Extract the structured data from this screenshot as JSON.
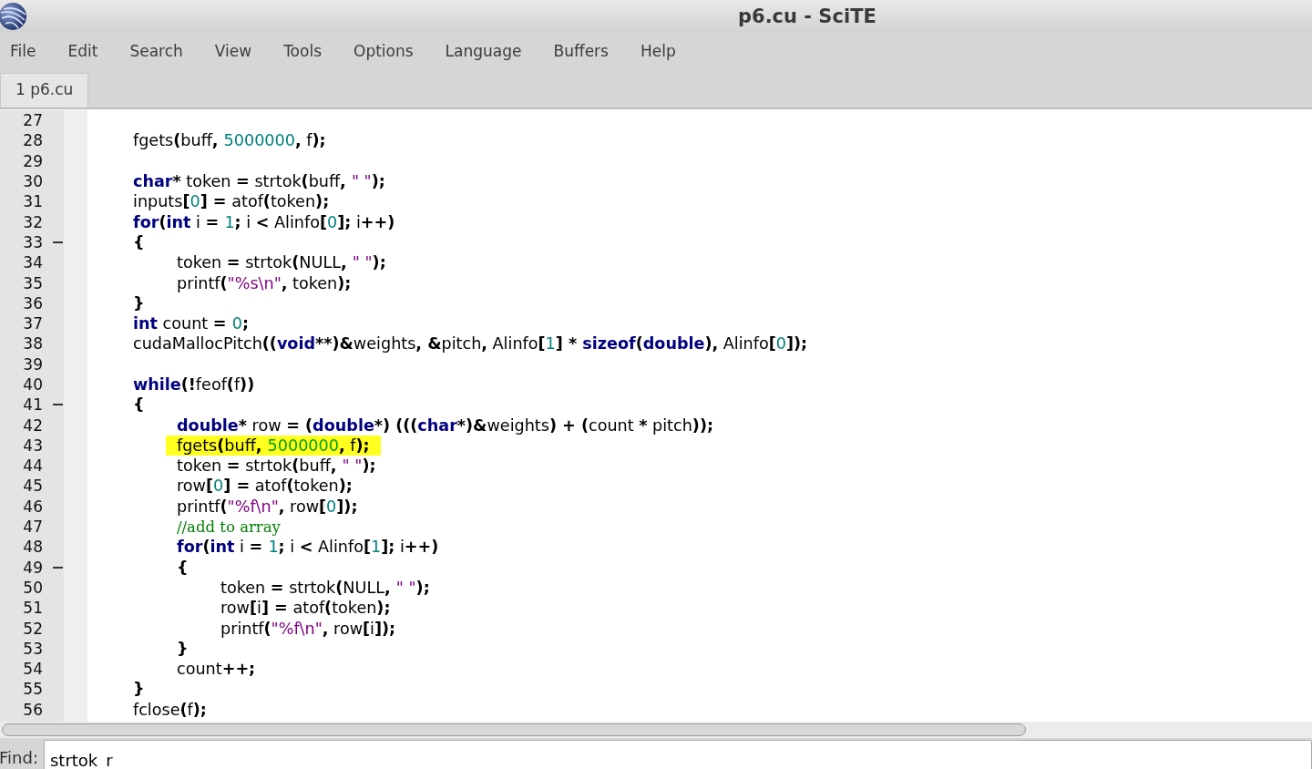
{
  "window": {
    "title": "p6.cu - SciTE"
  },
  "menu": [
    "File",
    "Edit",
    "Search",
    "View",
    "Tools",
    "Options",
    "Language",
    "Buffers",
    "Help"
  ],
  "tabs": [
    {
      "label": "1 p6.cu",
      "selected": true
    }
  ],
  "lines": [
    {
      "number": "27",
      "fold": false,
      "highlighted": false
    },
    {
      "number": "28",
      "fold": false,
      "highlighted": false,
      "segments": [
        {
          "kind": "id",
          "text": "fgets"
        },
        {
          "kind": "op",
          "text": "("
        },
        {
          "kind": "id",
          "text": "buff"
        },
        {
          "kind": "op",
          "text": ", "
        },
        {
          "kind": "num",
          "text": "5000000"
        },
        {
          "kind": "op",
          "text": ","
        },
        {
          "kind": "id",
          "text": " f"
        },
        {
          "kind": "op",
          "text": ");"
        }
      ]
    },
    {
      "number": "29",
      "fold": false,
      "highlighted": false
    },
    {
      "number": "30",
      "fold": false,
      "highlighted": false,
      "segments": [
        {
          "kind": "kw",
          "text": "char"
        },
        {
          "kind": "op",
          "text": "*"
        },
        {
          "kind": "id",
          "text": " token "
        },
        {
          "kind": "op",
          "text": "="
        },
        {
          "kind": "id",
          "text": " strtok"
        },
        {
          "kind": "op",
          "text": "("
        },
        {
          "kind": "id",
          "text": "buff"
        },
        {
          "kind": "op",
          "text": ", "
        },
        {
          "kind": "str",
          "text": "\" \""
        },
        {
          "kind": "op",
          "text": ");"
        }
      ]
    },
    {
      "number": "31",
      "fold": false,
      "highlighted": false,
      "segments": [
        {
          "kind": "id",
          "text": "inputs"
        },
        {
          "kind": "op",
          "text": "["
        },
        {
          "kind": "num",
          "text": "0"
        },
        {
          "kind": "op",
          "text": "] ="
        },
        {
          "kind": "id",
          "text": " atof"
        },
        {
          "kind": "op",
          "text": "("
        },
        {
          "kind": "id",
          "text": "token"
        },
        {
          "kind": "op",
          "text": ");"
        }
      ]
    },
    {
      "number": "32",
      "fold": false,
      "highlighted": false,
      "segments": [
        {
          "kind": "kw",
          "text": "for"
        },
        {
          "kind": "op",
          "text": "("
        },
        {
          "kind": "kw",
          "text": "int"
        },
        {
          "kind": "id",
          "text": " i "
        },
        {
          "kind": "op",
          "text": "= "
        },
        {
          "kind": "num",
          "text": "1"
        },
        {
          "kind": "op",
          "text": ";"
        },
        {
          "kind": "id",
          "text": " i "
        },
        {
          "kind": "op",
          "text": "<"
        },
        {
          "kind": "id",
          "text": " Alinfo"
        },
        {
          "kind": "op",
          "text": "["
        },
        {
          "kind": "num",
          "text": "0"
        },
        {
          "kind": "op",
          "text": "];"
        },
        {
          "kind": "id",
          "text": " i"
        },
        {
          "kind": "op",
          "text": "++)"
        }
      ]
    },
    {
      "number": "33",
      "fold": true,
      "highlighted": false,
      "segments": [
        {
          "kind": "op",
          "text": "{"
        }
      ],
      "children": [
        {
          "number": "34",
          "fold": false,
          "highlighted": false,
          "segments": [
            {
              "kind": "id",
              "text": "token "
            },
            {
              "kind": "op",
              "text": "="
            },
            {
              "kind": "id",
              "text": " strtok"
            },
            {
              "kind": "op",
              "text": "("
            },
            {
              "kind": "id",
              "text": "NULL"
            },
            {
              "kind": "op",
              "text": ", "
            },
            {
              "kind": "str",
              "text": "\" \""
            },
            {
              "kind": "op",
              "text": ");"
            }
          ]
        },
        {
          "number": "35",
          "fold": false,
          "highlighted": false,
          "segments": [
            {
              "kind": "id",
              "text": "printf"
            },
            {
              "kind": "op",
              "text": "("
            },
            {
              "kind": "str",
              "text": "\"%s\\n\""
            },
            {
              "kind": "op",
              "text": ","
            },
            {
              "kind": "id",
              "text": " token"
            },
            {
              "kind": "op",
              "text": ");"
            }
          ]
        }
      ]
    },
    {
      "number": "36",
      "fold": false,
      "highlighted": false,
      "segments": [
        {
          "kind": "op",
          "text": "}"
        }
      ]
    },
    {
      "number": "37",
      "fold": false,
      "highlighted": false,
      "segments": [
        {
          "kind": "kw",
          "text": "int"
        },
        {
          "kind": "id",
          "text": " count "
        },
        {
          "kind": "op",
          "text": "= "
        },
        {
          "kind": "num",
          "text": "0"
        },
        {
          "kind": "op",
          "text": ";"
        }
      ]
    },
    {
      "number": "38",
      "fold": false,
      "highlighted": false,
      "segments": [
        {
          "kind": "id",
          "text": "cudaMallocPitch"
        },
        {
          "kind": "op",
          "text": "(("
        },
        {
          "kind": "kw",
          "text": "void"
        },
        {
          "kind": "op",
          "text": "**)&"
        },
        {
          "kind": "id",
          "text": "weights"
        },
        {
          "kind": "op",
          "text": ", &"
        },
        {
          "kind": "id",
          "text": "pitch"
        },
        {
          "kind": "op",
          "text": ","
        },
        {
          "kind": "id",
          "text": " Alinfo"
        },
        {
          "kind": "op",
          "text": "["
        },
        {
          "kind": "num",
          "text": "1"
        },
        {
          "kind": "op",
          "text": "] * "
        },
        {
          "kind": "kw",
          "text": "sizeof"
        },
        {
          "kind": "op",
          "text": "("
        },
        {
          "kind": "kw",
          "text": "double"
        },
        {
          "kind": "op",
          "text": "),"
        },
        {
          "kind": "id",
          "text": " Alinfo"
        },
        {
          "kind": "op",
          "text": "["
        },
        {
          "kind": "num",
          "text": "0"
        },
        {
          "kind": "op",
          "text": "]);"
        }
      ]
    },
    {
      "number": "39",
      "fold": false,
      "highlighted": false
    },
    {
      "number": "40",
      "fold": false,
      "highlighted": false,
      "segments": [
        {
          "kind": "kw",
          "text": "while"
        },
        {
          "kind": "op",
          "text": "(!"
        },
        {
          "kind": "id",
          "text": "feof"
        },
        {
          "kind": "op",
          "text": "("
        },
        {
          "kind": "id",
          "text": "f"
        },
        {
          "kind": "op",
          "text": "))"
        }
      ]
    },
    {
      "number": "41",
      "fold": true,
      "highlighted": false,
      "segments": [
        {
          "kind": "op",
          "text": "{"
        }
      ],
      "children": [
        {
          "number": "42",
          "fold": false,
          "highlighted": false,
          "segments": [
            {
              "kind": "kw",
              "text": "double"
            },
            {
              "kind": "op",
              "text": "*"
            },
            {
              "kind": "id",
              "text": " row "
            },
            {
              "kind": "op",
              "text": "= ("
            },
            {
              "kind": "kw",
              "text": "double"
            },
            {
              "kind": "op",
              "text": "*) ((("
            },
            {
              "kind": "kw",
              "text": "char"
            },
            {
              "kind": "op",
              "text": "*)&"
            },
            {
              "kind": "id",
              "text": "weights"
            },
            {
              "kind": "op",
              "text": ") + ("
            },
            {
              "kind": "id",
              "text": "count "
            },
            {
              "kind": "op",
              "text": "*"
            },
            {
              "kind": "id",
              "text": " pitch"
            },
            {
              "kind": "op",
              "text": "));"
            }
          ]
        },
        {
          "number": "43",
          "fold": false,
          "highlighted": true,
          "segments": [
            {
              "kind": "id",
              "text": "fgets"
            },
            {
              "kind": "op",
              "text": "("
            },
            {
              "kind": "id",
              "text": "buff"
            },
            {
              "kind": "op",
              "text": ", "
            },
            {
              "kind": "num",
              "text": "5000000"
            },
            {
              "kind": "op",
              "text": ","
            },
            {
              "kind": "id",
              "text": " f"
            },
            {
              "kind": "op",
              "text": ");"
            }
          ]
        },
        {
          "number": "44",
          "fold": false,
          "highlighted": false,
          "segments": [
            {
              "kind": "id",
              "text": "token "
            },
            {
              "kind": "op",
              "text": "="
            },
            {
              "kind": "id",
              "text": " strtok"
            },
            {
              "kind": "op",
              "text": "("
            },
            {
              "kind": "id",
              "text": "buff"
            },
            {
              "kind": "op",
              "text": ", "
            },
            {
              "kind": "str",
              "text": "\" \""
            },
            {
              "kind": "op",
              "text": ");"
            }
          ]
        },
        {
          "number": "45",
          "fold": false,
          "highlighted": false,
          "segments": [
            {
              "kind": "id",
              "text": "row"
            },
            {
              "kind": "op",
              "text": "["
            },
            {
              "kind": "num",
              "text": "0"
            },
            {
              "kind": "op",
              "text": "] ="
            },
            {
              "kind": "id",
              "text": " atof"
            },
            {
              "kind": "op",
              "text": "("
            },
            {
              "kind": "id",
              "text": "token"
            },
            {
              "kind": "op",
              "text": ");"
            }
          ]
        },
        {
          "number": "46",
          "fold": false,
          "highlighted": false,
          "segments": [
            {
              "kind": "id",
              "text": "printf"
            },
            {
              "kind": "op",
              "text": "("
            },
            {
              "kind": "str",
              "text": "\"%f\\n\""
            },
            {
              "kind": "op",
              "text": ","
            },
            {
              "kind": "id",
              "text": " row"
            },
            {
              "kind": "op",
              "text": "["
            },
            {
              "kind": "num",
              "text": "0"
            },
            {
              "kind": "op",
              "text": "]);"
            }
          ]
        },
        {
          "number": "47",
          "fold": false,
          "highlighted": false,
          "segments": [
            {
              "kind": "cmt",
              "text": "//add to array"
            }
          ]
        },
        {
          "number": "48",
          "fold": false,
          "highlighted": false,
          "segments": [
            {
              "kind": "kw",
              "text": "for"
            },
            {
              "kind": "op",
              "text": "("
            },
            {
              "kind": "kw",
              "text": "int"
            },
            {
              "kind": "id",
              "text": " i "
            },
            {
              "kind": "op",
              "text": "= "
            },
            {
              "kind": "num",
              "text": "1"
            },
            {
              "kind": "op",
              "text": ";"
            },
            {
              "kind": "id",
              "text": " i "
            },
            {
              "kind": "op",
              "text": "<"
            },
            {
              "kind": "id",
              "text": " Alinfo"
            },
            {
              "kind": "op",
              "text": "["
            },
            {
              "kind": "num",
              "text": "1"
            },
            {
              "kind": "op",
              "text": "];"
            },
            {
              "kind": "id",
              "text": " i"
            },
            {
              "kind": "op",
              "text": "++)"
            }
          ]
        },
        {
          "number": "49",
          "fold": true,
          "highlighted": false,
          "segments": [
            {
              "kind": "op",
              "text": "{"
            }
          ],
          "children": [
            {
              "number": "50",
              "fold": false,
              "highlighted": false,
              "segments": [
                {
                  "kind": "id",
                  "text": "token "
                },
                {
                  "kind": "op",
                  "text": "="
                },
                {
                  "kind": "id",
                  "text": " strtok"
                },
                {
                  "kind": "op",
                  "text": "("
                },
                {
                  "kind": "id",
                  "text": "NULL"
                },
                {
                  "kind": "op",
                  "text": ", "
                },
                {
                  "kind": "str",
                  "text": "\" \""
                },
                {
                  "kind": "op",
                  "text": ");"
                }
              ]
            },
            {
              "number": "51",
              "fold": false,
              "highlighted": false,
              "segments": [
                {
                  "kind": "id",
                  "text": "row"
                },
                {
                  "kind": "op",
                  "text": "["
                },
                {
                  "kind": "id",
                  "text": "i"
                },
                {
                  "kind": "op",
                  "text": "] ="
                },
                {
                  "kind": "id",
                  "text": " atof"
                },
                {
                  "kind": "op",
                  "text": "("
                },
                {
                  "kind": "id",
                  "text": "token"
                },
                {
                  "kind": "op",
                  "text": ");"
                }
              ]
            },
            {
              "number": "52",
              "fold": false,
              "highlighted": false,
              "segments": [
                {
                  "kind": "id",
                  "text": "printf"
                },
                {
                  "kind": "op",
                  "text": "("
                },
                {
                  "kind": "str",
                  "text": "\"%f\\n\""
                },
                {
                  "kind": "op",
                  "text": ","
                },
                {
                  "kind": "id",
                  "text": " row"
                },
                {
                  "kind": "op",
                  "text": "["
                },
                {
                  "kind": "id",
                  "text": "i"
                },
                {
                  "kind": "op",
                  "text": "]);"
                }
              ]
            }
          ]
        },
        {
          "number": "53",
          "fold": false,
          "highlighted": false,
          "segments": [
            {
              "kind": "op",
              "text": "}"
            }
          ]
        },
        {
          "number": "54",
          "fold": false,
          "highlighted": false,
          "segments": [
            {
              "kind": "id",
              "text": "count"
            },
            {
              "kind": "op",
              "text": "++;"
            }
          ]
        }
      ]
    },
    {
      "number": "55",
      "fold": false,
      "highlighted": false,
      "segments": [
        {
          "kind": "op",
          "text": "}"
        }
      ]
    },
    {
      "number": "56",
      "fold": false,
      "highlighted": false,
      "segments": [
        {
          "kind": "id",
          "text": "fclose"
        },
        {
          "kind": "op",
          "text": "("
        },
        {
          "kind": "id",
          "text": "f"
        },
        {
          "kind": "op",
          "text": ");"
        }
      ]
    }
  ],
  "find": {
    "label": "Find:",
    "value": "strtok_r"
  }
}
